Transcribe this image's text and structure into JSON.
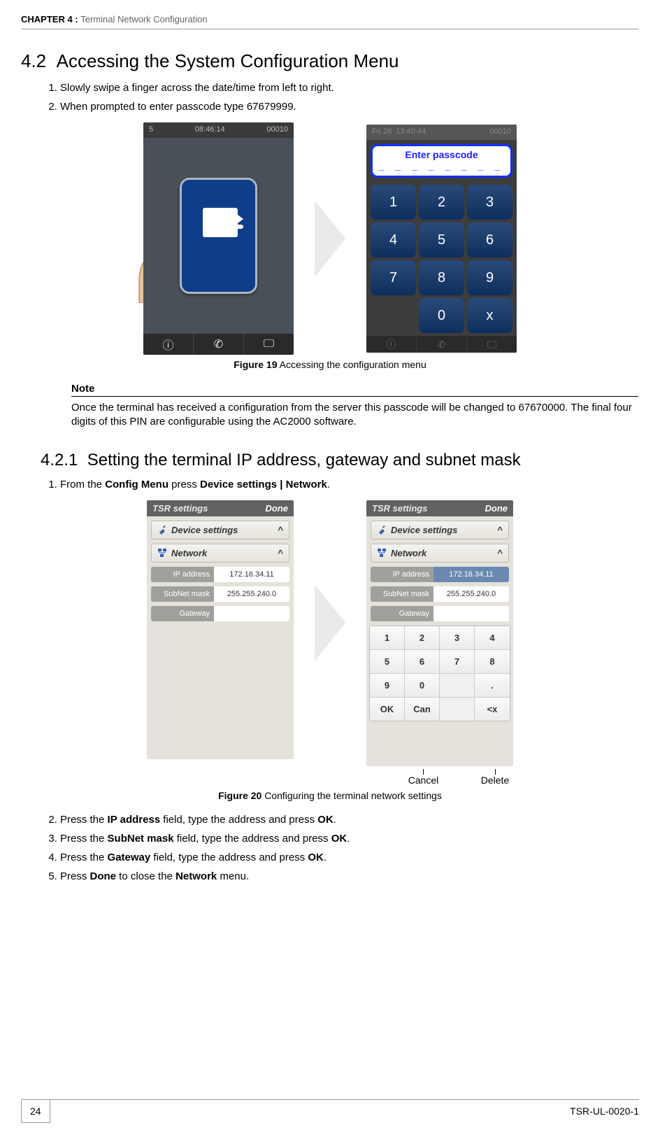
{
  "chapter": {
    "prefix": "CHAPTER 4 : ",
    "title": "Terminal Network Configuration"
  },
  "section42": {
    "num": "4.2",
    "title": "Accessing the System Configuration Menu",
    "steps": [
      "Slowly swipe a finger across the date/time from left to right.",
      "When prompted to enter passcode type 67679999."
    ]
  },
  "fig19": {
    "caption_bold": "Figure 19",
    "caption_rest": " Accessing the configuration menu",
    "left_device": {
      "time": "08:46:14",
      "right": "00010",
      "left": "5"
    },
    "right_device": {
      "topleft": "Fri 28",
      "toptime": "13:40:44",
      "topright": "00010",
      "title": "Enter passcode",
      "dashes": "_ _ _ _ _ _ _ _",
      "keys": [
        "1",
        "2",
        "3",
        "4",
        "5",
        "6",
        "7",
        "8",
        "9",
        "",
        "0",
        "x"
      ]
    }
  },
  "note": {
    "heading": "Note",
    "body": "Once the terminal has received a configuration from the server this passcode will be changed to 67670000. The final four digits of this PIN are configurable using the AC2000 software."
  },
  "section421": {
    "num": "4.2.1",
    "title": "Setting the terminal IP address, gateway and subnet mask",
    "step1_pre": "From the ",
    "cfgmenu": "Config Menu",
    "step1_mid": " press ",
    "devset": "Device settings | Network",
    "step1_end": "."
  },
  "fig20": {
    "caption_bold": "Figure 20",
    "caption_rest": " Configuring the terminal network settings",
    "titlebar": "TSR settings",
    "done": "Done",
    "panel_dev": "Device settings",
    "panel_net": "Network",
    "ip_label": "IP address",
    "ip_val": "172.16.34.11",
    "sn_label": "SubNet mask",
    "sn_val": "255.255.240.0",
    "gw_label": "Gateway",
    "gw_val": "",
    "numkeys": [
      "1",
      "2",
      "3",
      "4",
      "5",
      "6",
      "7",
      "8",
      "9",
      "0",
      "",
      ".",
      "OK",
      "Can",
      "",
      "<x"
    ],
    "cancel": "Cancel",
    "delete": "Delete"
  },
  "steps_after": {
    "s2a": "Press the ",
    "s2b": "IP address",
    "s2c": " field, type the address and press ",
    "ok": "OK",
    "dot": ".",
    "s3a": "Press the ",
    "s3b": "SubNet mask",
    "s3c": " field, type the address and press ",
    "s4a": "Press the ",
    "s4b": "Gateway",
    "s4c": " field, type the address and press ",
    "s5a": "Press ",
    "s5b": "Done",
    "s5c": " to close the ",
    "s5d": "Network",
    "s5e": " menu."
  },
  "footer": {
    "page": "24",
    "doc": "TSR-UL-0020-1"
  }
}
